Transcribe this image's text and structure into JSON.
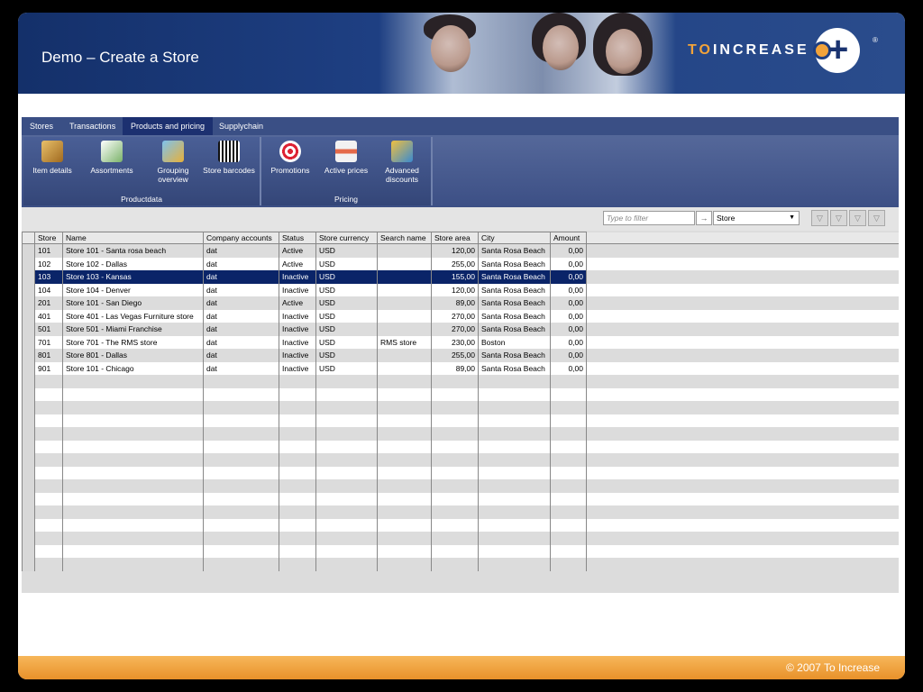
{
  "slide": {
    "title": "Demo – Create a Store",
    "footer": "© 2007 To Increase"
  },
  "logo": {
    "prefix": "TO",
    "name": "INCREASE",
    "mark": "+",
    "registered": "®"
  },
  "tabs": [
    {
      "label": "Stores",
      "active": false
    },
    {
      "label": "Transactions",
      "active": false
    },
    {
      "label": "Products and pricing",
      "active": true
    },
    {
      "label": "Supplychain",
      "active": false
    }
  ],
  "ribbon": {
    "groups": [
      {
        "label": "Productdata",
        "buttons": [
          {
            "label": "Item details",
            "icon": "item-details-icon"
          },
          {
            "label": "Assortments",
            "icon": "assortments-icon"
          },
          {
            "label": "Grouping overview",
            "icon": "grouping-overview-icon"
          },
          {
            "label": "Store barcodes",
            "icon": "store-barcodes-icon"
          }
        ]
      },
      {
        "label": "Pricing",
        "buttons": [
          {
            "label": "Promotions",
            "icon": "promotions-icon"
          },
          {
            "label": "Active prices",
            "icon": "active-prices-icon"
          },
          {
            "label": "Advanced discounts",
            "icon": "advanced-discounts-icon"
          }
        ]
      }
    ]
  },
  "filter": {
    "placeholder": "Type to filter",
    "arrow": "→",
    "field": "Store"
  },
  "grid": {
    "columns": [
      "Store",
      "Name",
      "Company accounts",
      "Status",
      "Store currency",
      "Search name",
      "Store area",
      "City",
      "Amount"
    ],
    "rows": [
      [
        "101",
        "Store 101 - Santa rosa beach",
        "dat",
        "Active",
        "USD",
        "",
        "120,00",
        "Santa Rosa Beach",
        "0,00"
      ],
      [
        "102",
        "Store 102 - Dallas",
        "dat",
        "Active",
        "USD",
        "",
        "255,00",
        "Santa Rosa Beach",
        "0,00"
      ],
      [
        "103",
        "Store 103 - Kansas",
        "dat",
        "Inactive",
        "USD",
        "",
        "155,00",
        "Santa Rosa Beach",
        "0,00"
      ],
      [
        "104",
        "Store 104 - Denver",
        "dat",
        "Inactive",
        "USD",
        "",
        "120,00",
        "Santa Rosa Beach",
        "0,00"
      ],
      [
        "201",
        "Store 101 - San Diego",
        "dat",
        "Active",
        "USD",
        "",
        "89,00",
        "Santa Rosa Beach",
        "0,00"
      ],
      [
        "401",
        "Store 401 - Las Vegas Furniture store",
        "dat",
        "Inactive",
        "USD",
        "",
        "270,00",
        "Santa Rosa Beach",
        "0,00"
      ],
      [
        "501",
        "Store 501 - Miami Franchise",
        "dat",
        "Inactive",
        "USD",
        "",
        "270,00",
        "Santa Rosa Beach",
        "0,00"
      ],
      [
        "701",
        "Store 701 - The RMS store",
        "dat",
        "Inactive",
        "USD",
        "RMS store",
        "230,00",
        "Boston",
        "0,00"
      ],
      [
        "801",
        "Store 801 - Dallas",
        "dat",
        "Inactive",
        "USD",
        "",
        "255,00",
        "Santa Rosa Beach",
        "0,00"
      ],
      [
        "901",
        "Store 101 - Chicago",
        "dat",
        "Inactive",
        "USD",
        "",
        "89,00",
        "Santa Rosa Beach",
        "0,00"
      ]
    ],
    "selected_row": 2,
    "empty_rows": 15
  },
  "colors": {
    "header": "#1e3f82",
    "accent": "#f2a33a",
    "selection": "#0a2468",
    "footer": "#e8912a"
  }
}
